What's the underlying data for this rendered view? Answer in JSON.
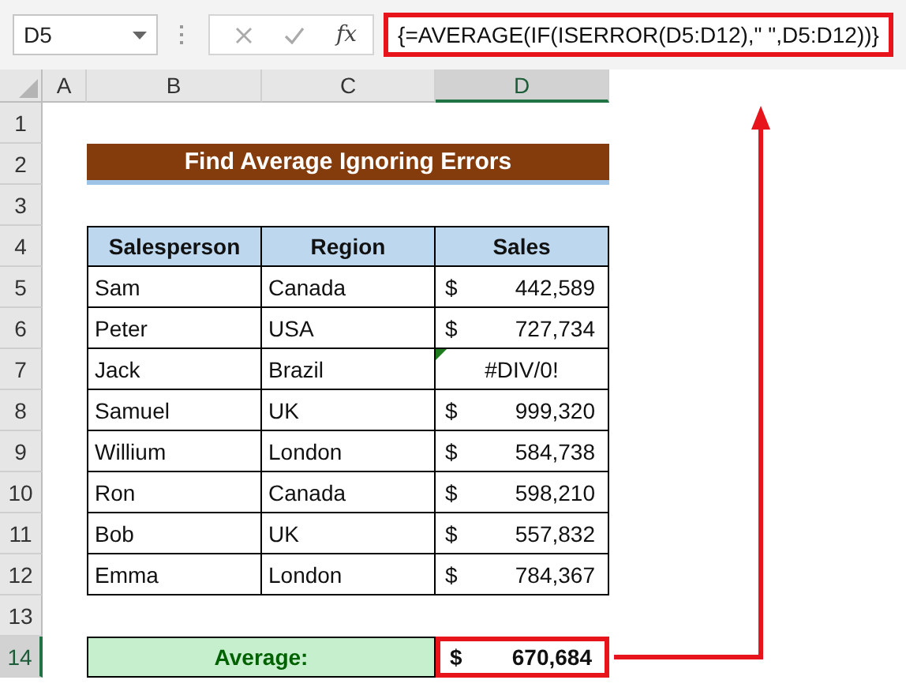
{
  "formula_bar": {
    "name_box": "D5",
    "function_label": "fx",
    "formula": "{=AVERAGE(IF(ISERROR(D5:D12),\" \",D5:D12))}",
    "highlighted": true
  },
  "columns": [
    {
      "label": "A",
      "selected": false
    },
    {
      "label": "B",
      "selected": false
    },
    {
      "label": "C",
      "selected": false
    },
    {
      "label": "D",
      "selected": true
    }
  ],
  "rows": [
    {
      "label": "1",
      "selected": false
    },
    {
      "label": "2",
      "selected": false
    },
    {
      "label": "3",
      "selected": false
    },
    {
      "label": "4",
      "selected": false
    },
    {
      "label": "5",
      "selected": false
    },
    {
      "label": "6",
      "selected": false
    },
    {
      "label": "7",
      "selected": false
    },
    {
      "label": "8",
      "selected": false
    },
    {
      "label": "9",
      "selected": false
    },
    {
      "label": "10",
      "selected": false
    },
    {
      "label": "11",
      "selected": false
    },
    {
      "label": "12",
      "selected": false
    },
    {
      "label": "13",
      "selected": false
    },
    {
      "label": "14",
      "selected": true
    }
  ],
  "title": "Find Average Ignoring Errors",
  "table": {
    "columns": [
      "Salesperson",
      "Region",
      "Sales"
    ],
    "rows": [
      {
        "salesperson": "Sam",
        "region": "Canada",
        "sales": {
          "kind": "currency",
          "symbol": "$",
          "amount": "442,589"
        }
      },
      {
        "salesperson": "Peter",
        "region": "USA",
        "sales": {
          "kind": "currency",
          "symbol": "$",
          "amount": "727,734"
        }
      },
      {
        "salesperson": "Jack",
        "region": "Brazil",
        "sales": {
          "kind": "error",
          "text": "#DIV/0!"
        }
      },
      {
        "salesperson": "Samuel",
        "region": "UK",
        "sales": {
          "kind": "currency",
          "symbol": "$",
          "amount": "999,320"
        }
      },
      {
        "salesperson": "Willium",
        "region": "London",
        "sales": {
          "kind": "currency",
          "symbol": "$",
          "amount": "584,738"
        }
      },
      {
        "salesperson": "Ron",
        "region": "Canada",
        "sales": {
          "kind": "currency",
          "symbol": "$",
          "amount": "598,210"
        }
      },
      {
        "salesperson": "Bob",
        "region": "UK",
        "sales": {
          "kind": "currency",
          "symbol": "$",
          "amount": "557,832"
        }
      },
      {
        "salesperson": "Emma",
        "region": "London",
        "sales": {
          "kind": "currency",
          "symbol": "$",
          "amount": "784,367"
        }
      }
    ]
  },
  "average": {
    "label": "Average:",
    "symbol": "$",
    "amount": "670,684",
    "highlighted": true
  }
}
